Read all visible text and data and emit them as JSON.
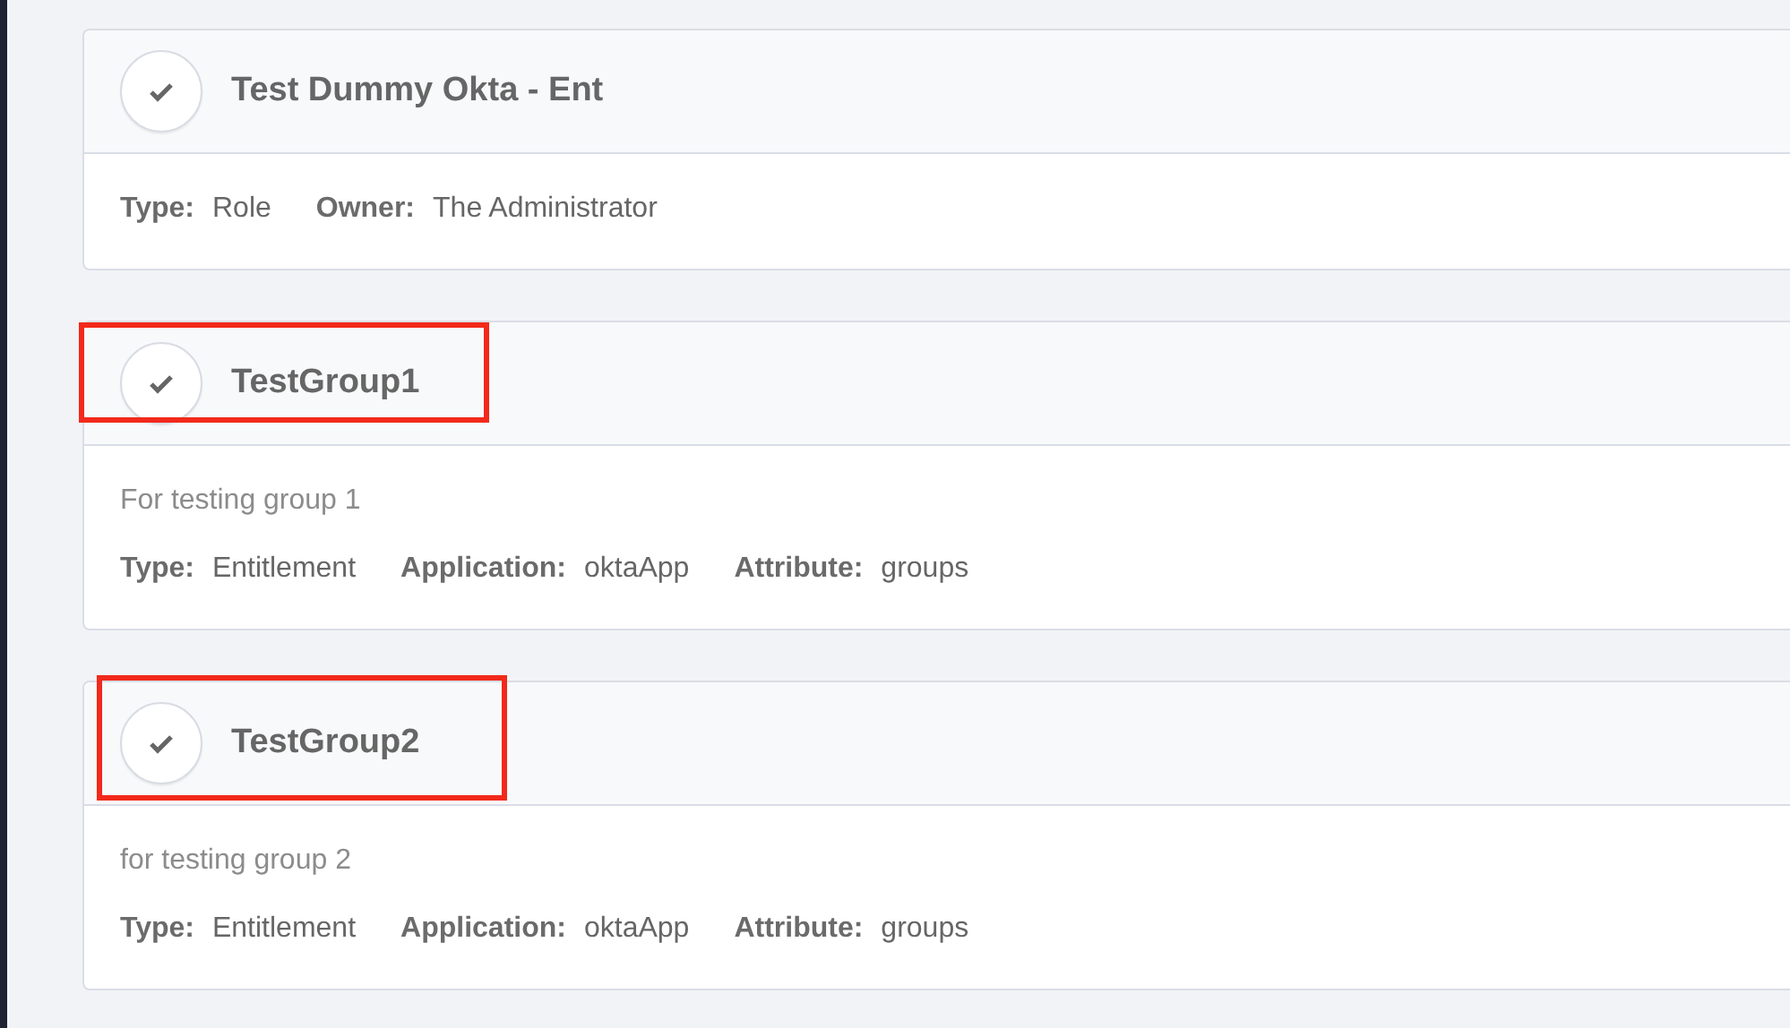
{
  "cards": [
    {
      "title": "Test Dummy Okta - Ent",
      "checked": true,
      "highlighted": false,
      "fields": [
        {
          "label": "Type:",
          "value": "Role"
        },
        {
          "label": "Owner:",
          "value": "The Administrator"
        }
      ]
    },
    {
      "title": "TestGroup1",
      "checked": true,
      "highlighted": true,
      "description": "For testing group 1",
      "fields": [
        {
          "label": "Type:",
          "value": "Entitlement"
        },
        {
          "label": "Application:",
          "value": "oktaApp"
        },
        {
          "label": "Attribute:",
          "value": "groups"
        }
      ]
    },
    {
      "title": "TestGroup2",
      "checked": true,
      "highlighted": true,
      "description": "for testing group 2",
      "fields": [
        {
          "label": "Type:",
          "value": "Entitlement"
        },
        {
          "label": "Application:",
          "value": "oktaApp"
        },
        {
          "label": "Attribute:",
          "value": "groups"
        }
      ]
    }
  ]
}
